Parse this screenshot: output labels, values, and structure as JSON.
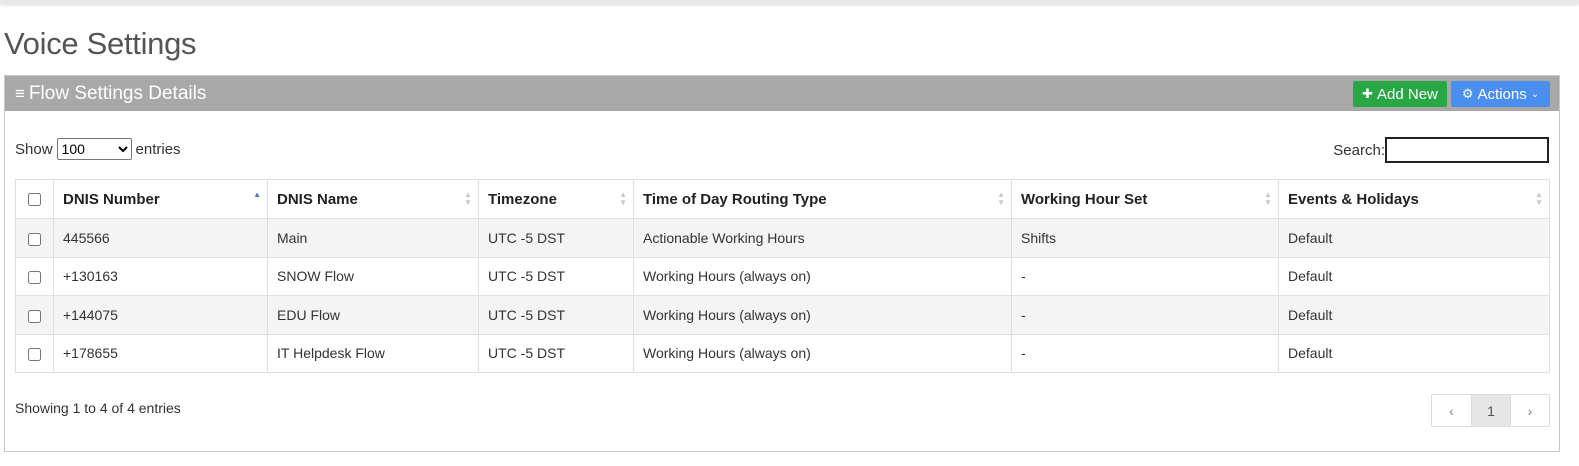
{
  "page": {
    "title": "Voice Settings"
  },
  "panel": {
    "title": "Flow Settings Details",
    "add_button": "Add New",
    "actions_button": "Actions",
    "colors": {
      "header_bg": "#a8a8a8",
      "add_green": "#28a745",
      "actions_blue": "#4a8ef0"
    }
  },
  "length_control": {
    "prefix": "Show",
    "selected": "100",
    "suffix": "entries"
  },
  "search": {
    "label": "Search:",
    "value": ""
  },
  "table": {
    "columns": [
      "DNIS Number",
      "DNIS Name",
      "Timezone",
      "Time of Day Routing Type",
      "Working Hour Set",
      "Events & Holidays"
    ],
    "rows": [
      [
        "445566",
        "Main",
        "UTC -5 DST",
        "Actionable Working Hours",
        "Shifts",
        "Default"
      ],
      [
        "+130163",
        "SNOW Flow",
        "UTC -5 DST",
        "Working Hours (always on)",
        "-",
        "Default"
      ],
      [
        "+144075",
        "EDU Flow",
        "UTC -5 DST",
        "Working Hours (always on)",
        "-",
        "Default"
      ],
      [
        "+178655",
        "IT Helpdesk Flow",
        "UTC -5 DST",
        "Working Hours (always on)",
        "-",
        "Default"
      ]
    ]
  },
  "footer": {
    "info": "Showing 1 to 4 of 4 entries"
  },
  "pagination": {
    "prev": "‹",
    "current_page": "1",
    "next": "›"
  }
}
